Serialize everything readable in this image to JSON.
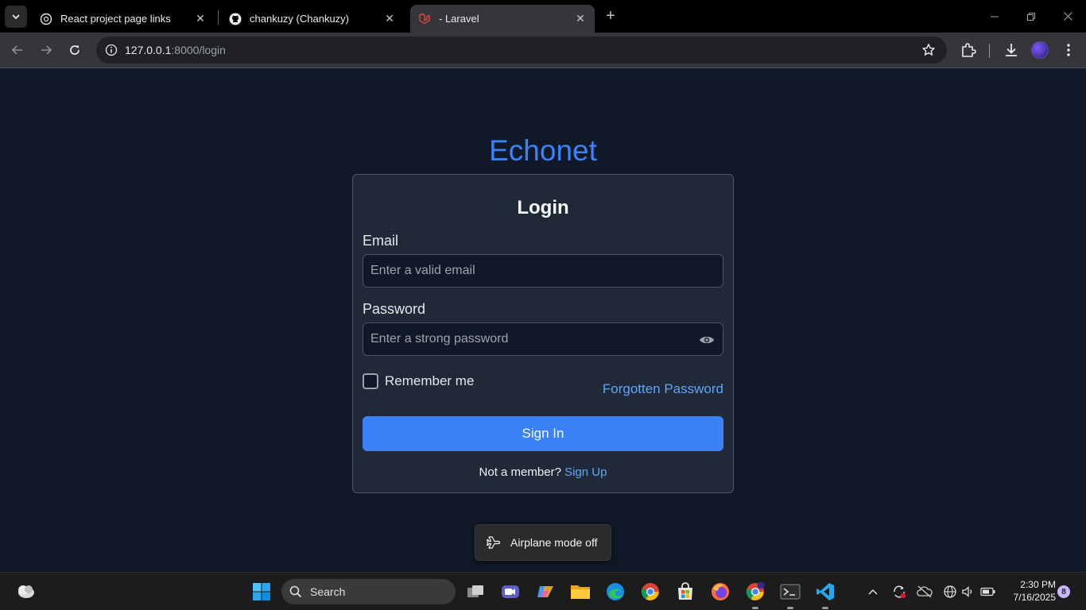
{
  "browser": {
    "tabs": [
      {
        "title": "React project page links",
        "active": false
      },
      {
        "title": "chankuzy (Chankuzy)",
        "active": false
      },
      {
        "title": "- Laravel",
        "active": true
      }
    ],
    "url": {
      "host": "127.0.0.1",
      "path": ":8000/login"
    }
  },
  "page": {
    "brand": "Echonet",
    "title": "Login",
    "email": {
      "label": "Email",
      "placeholder": "Enter a valid email",
      "value": ""
    },
    "password": {
      "label": "Password",
      "placeholder": "Enter a strong password",
      "value": ""
    },
    "remember_label": "Remember me",
    "remember_checked": false,
    "forgot_label": "Forgotten Password",
    "submit_label": "Sign In",
    "signup_prompt": "Not a member?",
    "signup_label": "Sign Up"
  },
  "toast": {
    "text": "Airplane mode off"
  },
  "taskbar": {
    "search_label": "Search",
    "time": "2:30 PM",
    "date": "7/16/2025",
    "notification_count": "8"
  },
  "colors": {
    "background": "#111827",
    "card": "#1f2937",
    "accent": "#3b82f6",
    "link": "#60a5fa"
  }
}
